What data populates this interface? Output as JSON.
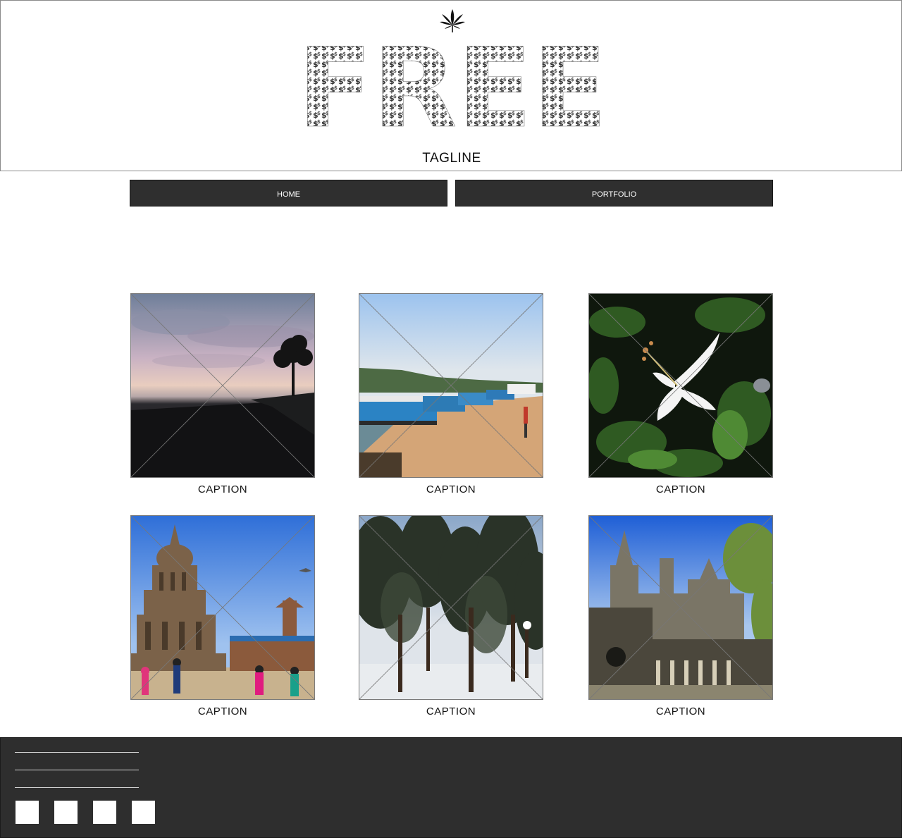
{
  "header": {
    "logo_text": "FREE",
    "logo_glyph": "$",
    "tagline": "TAGLINE",
    "icon": "cannabis-leaf-icon"
  },
  "nav": {
    "home_label": "HOME",
    "portfolio_label": "PORTFOLIO"
  },
  "gallery": {
    "items": [
      {
        "caption": "CAPTION",
        "scene": "sunset beach silhouette"
      },
      {
        "caption": "CAPTION",
        "scene": "boats on river bank"
      },
      {
        "caption": "CAPTION",
        "scene": "white hibiscus flower"
      },
      {
        "caption": "CAPTION",
        "scene": "temple square"
      },
      {
        "caption": "CAPTION",
        "scene": "pine trees in snow"
      },
      {
        "caption": "CAPTION",
        "scene": "ornate palace"
      }
    ]
  },
  "footer": {
    "link_lines": 3,
    "social_icons": [
      "social-icon-1",
      "social-icon-2",
      "social-icon-3",
      "social-icon-4"
    ]
  },
  "colors": {
    "nav_bg": "#2f2f2f",
    "footer_bg": "#2e2e2e",
    "border": "#8a8a8a"
  }
}
